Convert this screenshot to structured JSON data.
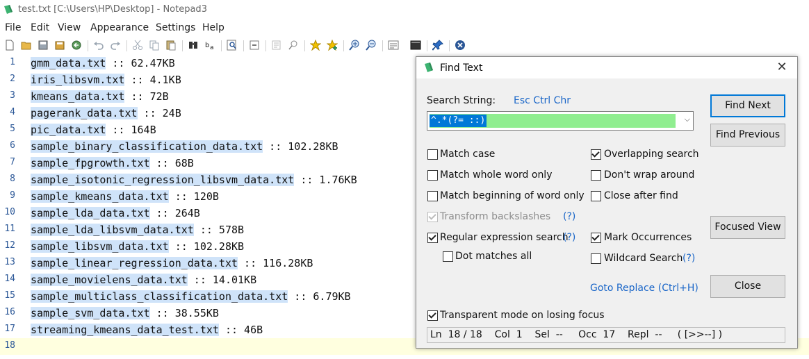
{
  "window": {
    "title": "test.txt [C:\\Users\\HP\\Desktop] - Notepad3"
  },
  "menu": [
    "File",
    "Edit",
    "View",
    "Appearance",
    "Settings",
    "Help"
  ],
  "toolbar_icons": [
    "new-icon",
    "open-icon",
    "save-icon",
    "save-as-icon",
    "revert-icon",
    "undo-icon",
    "redo-icon",
    "cut-icon",
    "copy-icon",
    "paste-icon",
    "find-icon",
    "replace-icon",
    "find-in-files-icon",
    "zoom-fit-icon",
    "select-icon",
    "goto-icon",
    "favorite-icon",
    "add-favorite-icon",
    "zoom-in-icon",
    "zoom-out-icon",
    "word-wrap-icon",
    "console-icon",
    "pin-icon",
    "close-doc-icon"
  ],
  "editor": {
    "lines": [
      {
        "num": "1",
        "name": "gmm_data.txt",
        "rest": " :: 62.47KB"
      },
      {
        "num": "2",
        "name": "iris_libsvm.txt",
        "rest": " :: 4.1KB"
      },
      {
        "num": "3",
        "name": "kmeans_data.txt",
        "rest": " :: 72B"
      },
      {
        "num": "4",
        "name": "pagerank_data.txt",
        "rest": " :: 24B"
      },
      {
        "num": "5",
        "name": "pic_data.txt",
        "rest": " :: 164B"
      },
      {
        "num": "6",
        "name": "sample_binary_classification_data.txt",
        "rest": " :: 102.28KB"
      },
      {
        "num": "7",
        "name": "sample_fpgrowth.txt",
        "rest": " :: 68B"
      },
      {
        "num": "8",
        "name": "sample_isotonic_regression_libsvm_data.txt",
        "rest": " :: 1.76KB"
      },
      {
        "num": "9",
        "name": "sample_kmeans_data.txt",
        "rest": " :: 120B"
      },
      {
        "num": "10",
        "name": "sample_lda_data.txt",
        "rest": " :: 264B"
      },
      {
        "num": "11",
        "name": "sample_lda_libsvm_data.txt",
        "rest": " :: 578B"
      },
      {
        "num": "12",
        "name": "sample_libsvm_data.txt",
        "rest": " :: 102.28KB"
      },
      {
        "num": "13",
        "name": "sample_linear_regression_data.txt",
        "rest": " :: 116.28KB"
      },
      {
        "num": "14",
        "name": "sample_movielens_data.txt",
        "rest": " :: 14.01KB"
      },
      {
        "num": "15",
        "name": "sample_multiclass_classification_data.txt",
        "rest": " :: 6.79KB"
      },
      {
        "num": "16",
        "name": "sample_svm_data.txt",
        "rest": " :: 38.55KB"
      },
      {
        "num": "17",
        "name": "streaming_kmeans_data_test.txt",
        "rest": " :: 46B"
      },
      {
        "num": "18",
        "name": "",
        "rest": ""
      }
    ]
  },
  "find_dialog": {
    "title": "Find Text",
    "close_glyph": "✕",
    "search_label": "Search String:",
    "esc_link": "Esc Ctrl Chr",
    "search_value": "^.*(?= ::)",
    "buttons": {
      "find_next": "Find Next",
      "find_previous": "Find Previous",
      "focused_view": "Focused View",
      "close": "Close"
    },
    "options": {
      "match_case": "Match case",
      "whole_word": "Match whole word only",
      "beginning_word": "Match beginning of word only",
      "transform_backslashes": "Transform backslashes",
      "regex": "Regular expression search",
      "dot_all": "Dot matches all",
      "overlapping": "Overlapping search",
      "dont_wrap": "Don't wrap around",
      "close_after_find": "Close after find",
      "mark_occurrences": "Mark Occurrences",
      "wildcard": "Wildcard Search",
      "transparent": "Transparent mode on losing focus"
    },
    "help_link": "(?)",
    "goto_replace": "Goto Replace (Ctrl+H)",
    "status": "Ln  18 / 18    Col  1    Sel  --     Occ  17    Repl  --     ( [>>--] )"
  }
}
